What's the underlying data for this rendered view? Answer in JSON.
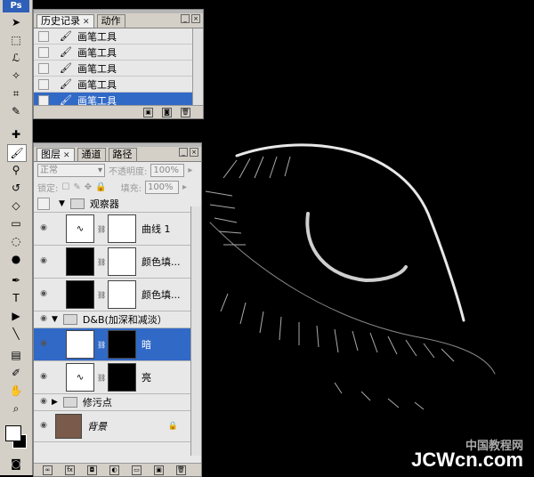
{
  "toolbox": {
    "logo": "Ps"
  },
  "history": {
    "tabs": [
      {
        "label": "历史记录"
      },
      {
        "label": "动作"
      }
    ],
    "items": [
      {
        "label": "画笔工具"
      },
      {
        "label": "画笔工具"
      },
      {
        "label": "画笔工具"
      },
      {
        "label": "画笔工具"
      },
      {
        "label": "画笔工具"
      }
    ]
  },
  "layers": {
    "tabs": [
      {
        "label": "图层"
      },
      {
        "label": "通道"
      },
      {
        "label": "路径"
      }
    ],
    "blend_mode": "正常",
    "opacity_label": "不透明度:",
    "opacity_value": "100%",
    "lock_label": "锁定:",
    "fill_label": "填充:",
    "fill_value": "100%",
    "items": [
      {
        "label": "观察器"
      },
      {
        "label": "曲线 1"
      },
      {
        "label": "颜色填..."
      },
      {
        "label": "颜色填..."
      },
      {
        "label": "D&B(加深和减淡）"
      },
      {
        "label": "暗"
      },
      {
        "label": "亮"
      },
      {
        "label": "修污点"
      },
      {
        "label": "背景"
      }
    ]
  },
  "watermark": {
    "top": "中国教程网",
    "main": "JCWcn.com"
  },
  "colors": {
    "selection": "#3169c6",
    "panel": "#e8e8e8",
    "chrome": "#d4d0c8"
  }
}
